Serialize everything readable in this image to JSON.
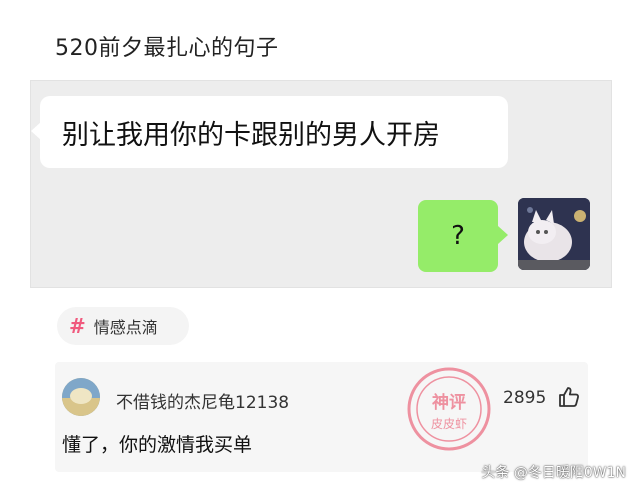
{
  "post": {
    "title": "520前夕最扎心的句子"
  },
  "chat": {
    "received_message": "别让我用你的卡跟别的男人开房",
    "sent_message": "?",
    "colors": {
      "background": "#ededed",
      "sent_bubble": "#95ec69",
      "received_bubble": "#ffffff"
    }
  },
  "tag": {
    "icon": "hash-icon",
    "label": "情感点滴",
    "color": "#f05a7e"
  },
  "comment": {
    "username": "不借钱的杰尼龟12138",
    "like_count": "2895",
    "like_icon": "thumbs-up-icon",
    "text": "懂了，你的激情我买单"
  },
  "stamp": {
    "top_text": "神评",
    "bottom_text": "皮皮虾",
    "color": "#e8405a"
  },
  "watermark": {
    "text": "头条 @冬日暖阳0W1N"
  }
}
